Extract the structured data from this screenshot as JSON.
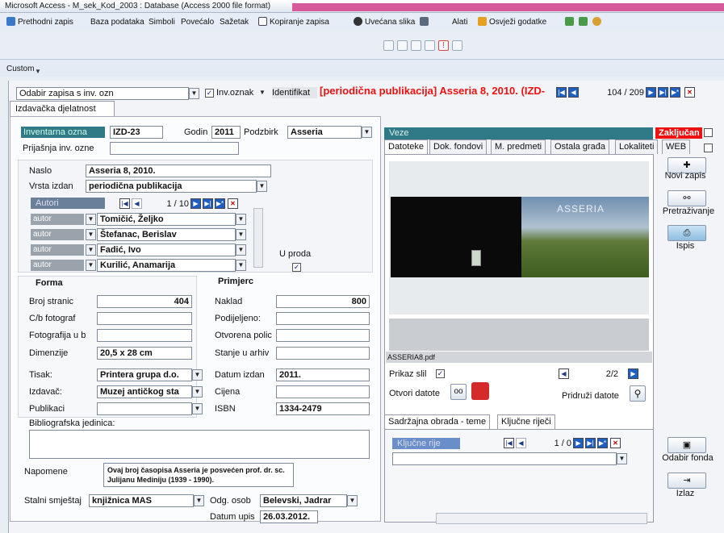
{
  "window": {
    "title": "Microsoft Access - M_sek_Kod_2003 : Database (Access 2000 file format)"
  },
  "menu": {
    "items": [
      {
        "label": "Prethodni zapis",
        "icon": "back-arrow-icon"
      },
      {
        "label": "Baza podataka",
        "icon": ""
      },
      {
        "label": "Simboli",
        "icon": ""
      },
      {
        "label": "Povećalo",
        "icon": ""
      },
      {
        "label": "Sažetak",
        "icon": ""
      },
      {
        "label": "Kopiranje zapisa",
        "icon": "copy-record-icon"
      },
      {
        "label": "Uvećana slika",
        "icon": "glasses-icon"
      },
      {
        "label": "",
        "icon": "grid-icon"
      },
      {
        "label": "Alati",
        "icon": ""
      },
      {
        "label": "Osvježi godatke",
        "icon": "refresh-icon"
      }
    ]
  },
  "custom_toolbar": {
    "label": "Custom"
  },
  "record_nav": {
    "selector_value": "Odabir zapisa s inv. ozn",
    "inv_checkbox_label": "Inv.oznak",
    "identifier_label": "Identifikat",
    "identifier_value": "[periodična publikacija] Asseria 8, 2010. (IZD-",
    "position": "104 / 209"
  },
  "main_tab": {
    "label": "Izdavačka djelatnost"
  },
  "form": {
    "inventarna_label": "Inventarna ozna",
    "inventarna_value": "IZD-23",
    "godina_label": "Godin",
    "godina_value": "2011",
    "podzbirka_label": "Podzbirk",
    "podzbirka_value": "Asseria",
    "prijasnja_label": "Prijašnja inv. ozne",
    "naslov_label": "Naslo",
    "naslov_value": "Asseria 8, 2010.",
    "vrsta_label": "Vrsta izdan",
    "vrsta_value": "periodična publikacija",
    "autori": {
      "header": "Autori",
      "position": "1 / 10",
      "rows": [
        {
          "role": "autor",
          "name": "Tomičić, Željko"
        },
        {
          "role": "autor",
          "name": "Štefanac, Berislav"
        },
        {
          "role": "autor",
          "name": "Fadić, Ivo"
        },
        {
          "role": "autor",
          "name": "Kurilić, Anamarija"
        }
      ]
    },
    "u_prodaji_label": "U proda",
    "forma": {
      "header": "Forma",
      "broj_stranica_label": "Broj stranic",
      "broj_stranica_value": "404",
      "cb_foto_label": "C/b fotograf",
      "foto_u_boji_label": "Fotografija u b",
      "dimenzije_label": "Dimenzije",
      "dimenzije_value": "20,5 x 28 cm",
      "tisak_label": "Tisak:",
      "tisak_value": "Printera grupa d.o.",
      "izdavac_label": "Izdavač:",
      "izdavac_value": "Muzej antičkog sta",
      "publikacija_label": "Publikaci"
    },
    "primjerci": {
      "header": "Primjerc",
      "naklada_label": "Naklad",
      "naklada_value": "800",
      "podijeljeno_label": "Podijeljeno:",
      "otvorena_label": "Otvorena polic",
      "stanje_label": "Stanje u arhiv",
      "datum_izdanja_label": "Datum izdan",
      "datum_izdanja_value": "2011.",
      "cijena_label": "Cijena",
      "isbn_label": "ISBN",
      "isbn_value": "1334-2479"
    },
    "bibliografska_label": "Bibliografska jedinica:",
    "napomene_label": "Napomene",
    "napomene_value": "Ovaj broj časopisa Asseria je posvećen prof. dr. sc. Julijanu Mediniju (1939 - 1990).",
    "stalni_label": "Stalni smještaj",
    "stalni_value": "knjižnica MAS",
    "odg_label": "Odg. osob",
    "odg_value": "Belevski, Jadrar",
    "datum_upisa_label": "Datum upis",
    "datum_upisa_value": "26.03.2012."
  },
  "veze": {
    "header": "Veze",
    "zakljucan_label": "Zaključan",
    "tabs": [
      "Datoteke",
      "Dok. fondovi",
      "M. predmeti",
      "Ostala građa",
      "Lokaliteti",
      "WEB"
    ],
    "file_name": "ASSERIA8.pdf",
    "preview_logo_text": "ASSERIA",
    "prikaz_label": "Prikaz slil",
    "slide_position": "2/2",
    "otvori_label": "Otvori datote",
    "pridruzi_label": "Pridruži datote"
  },
  "lower_tabs": {
    "tabs": [
      "Sadržajna obrada - teme",
      "Ključne riječi"
    ],
    "kljucne_header": "Ključne rije",
    "position": "1 / 0"
  },
  "right_buttons": {
    "novi_zapis": "Novi zapis",
    "pretrazivanje": "Pretraživanje",
    "ispis": "Ispis",
    "odabir_fonda": "Odabir fonda",
    "izlaz": "Izlaz"
  },
  "colors": {
    "teal": "#2f7a86",
    "slate": "#6a7f9a",
    "red_accent": "#e11111",
    "titlebar_pink": "#d85a9a"
  }
}
